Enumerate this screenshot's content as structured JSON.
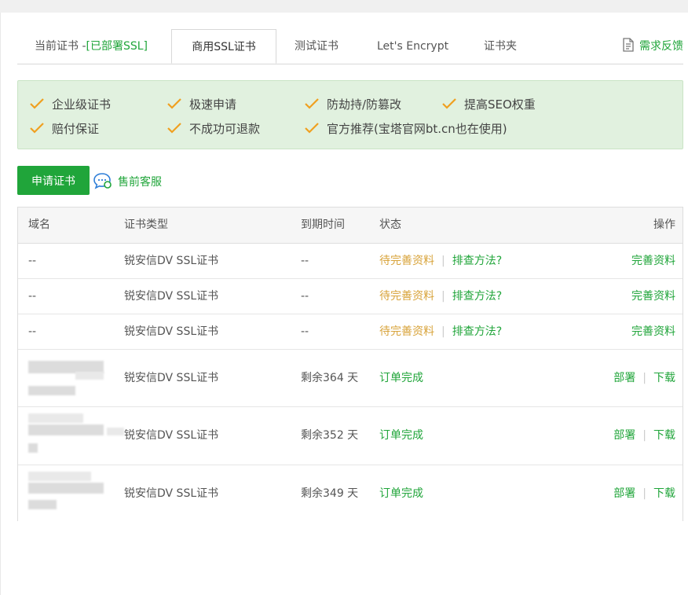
{
  "tabs": [
    {
      "label": "当前证书 -",
      "extra": "[已部署SSL]"
    },
    {
      "label": "商用SSL证书"
    },
    {
      "label": "测试证书"
    },
    {
      "label": "Let's Encrypt"
    },
    {
      "label": "证书夹"
    }
  ],
  "feedback": {
    "label": "需求反馈",
    "icon": "edit-document-icon"
  },
  "features": [
    "企业级证书",
    "极速申请",
    "防劫持/防篡改",
    "提高SEO权重",
    "赔付保证",
    "不成功可退款",
    "官方推荐(宝塔官网bt.cn也在使用)"
  ],
  "actions": {
    "apply_label": "申请证书",
    "presale_label": "售前客服",
    "presale_icon": "chat-bubble-icon"
  },
  "table": {
    "headers": {
      "domain": "域名",
      "type": "证书类型",
      "expiry": "到期时间",
      "status": "状态",
      "op": "操作"
    },
    "rows": [
      {
        "domain": "--",
        "type": "锐安信DV SSL证书",
        "expiry": "--",
        "status": "待完善资料",
        "status_link": "排查方法?",
        "ops": [
          "完善资料"
        ]
      },
      {
        "domain": "--",
        "type": "锐安信DV SSL证书",
        "expiry": "--",
        "status": "待完善资料",
        "status_link": "排查方法?",
        "ops": [
          "完善资料"
        ]
      },
      {
        "domain": "--",
        "type": "锐安信DV SSL证书",
        "expiry": "--",
        "status": "待完善资料",
        "status_link": "排查方法?",
        "ops": [
          "完善资料"
        ]
      },
      {
        "domain": "",
        "type": "锐安信DV SSL证书",
        "expiry": "剩余364 天",
        "status": "订单完成",
        "ops": [
          "部署",
          "下载"
        ]
      },
      {
        "domain": "",
        "type": "锐安信DV SSL证书",
        "expiry": "剩余352 天",
        "status": "订单完成",
        "ops": [
          "部署",
          "下载"
        ]
      },
      {
        "domain": "",
        "type": "锐安信DV SSL证书",
        "expiry": "剩余349 天",
        "status": "订单完成",
        "ops": [
          "部署",
          "下载"
        ]
      }
    ],
    "separator": "|"
  },
  "colors": {
    "accent": "#20a53a",
    "pending": "#d8a33a",
    "feature_bg": "#e1f1df",
    "check": "#f0a020"
  }
}
